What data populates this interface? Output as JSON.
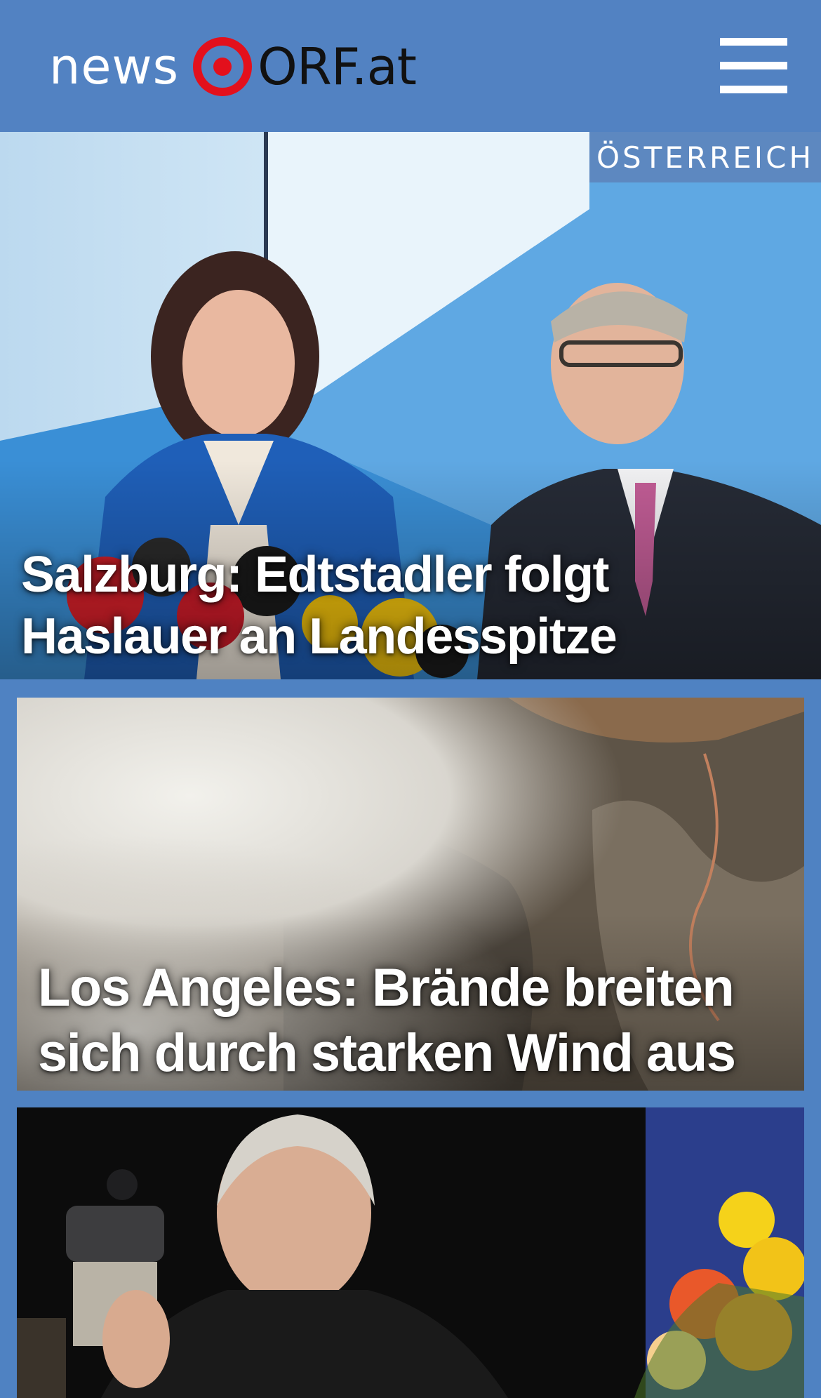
{
  "header": {
    "logo_text_news": "news",
    "logo_text_orf": "ORF.at",
    "logo_mark_color": "#e3101c",
    "background_color": "#5282c2",
    "menu_icon": "hamburger-menu-icon"
  },
  "stories": [
    {
      "category": "ÖSTERREICH",
      "headline": "Salzburg: Edtstadler folgt Haslauer an Landesspitze"
    },
    {
      "category": "",
      "headline": "Los Angeles: Brände breiten sich durch starken Wind aus"
    },
    {
      "category": "",
      "headline": ""
    }
  ]
}
